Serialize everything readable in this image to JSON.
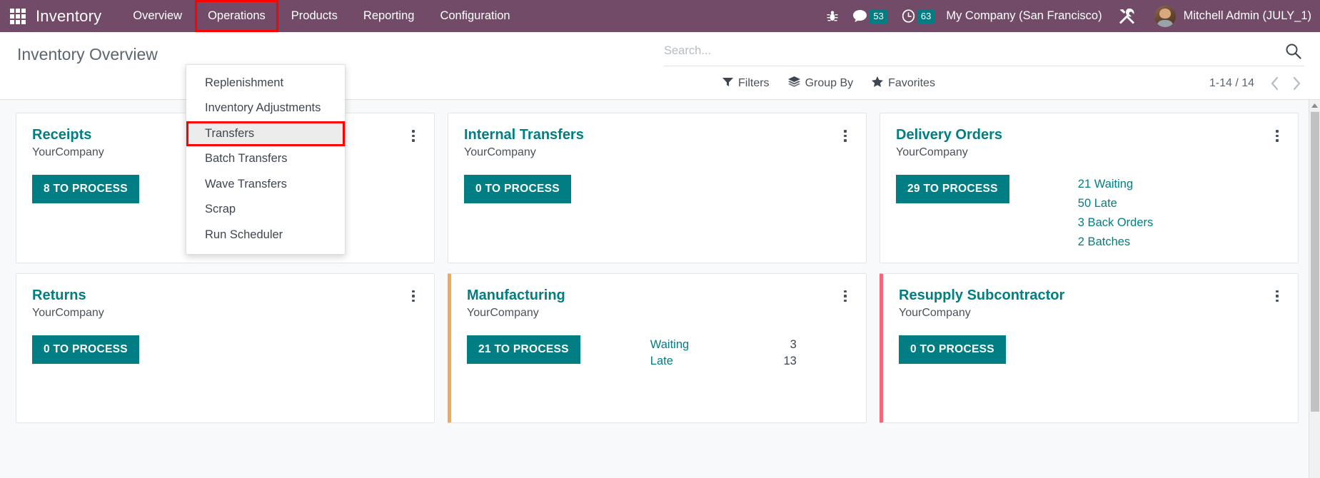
{
  "navbar": {
    "apps_icon": "apps-grid-icon",
    "brand": "Inventory",
    "menu": [
      {
        "label": "Overview",
        "highlighted": false
      },
      {
        "label": "Operations",
        "highlighted": true
      },
      {
        "label": "Products",
        "highlighted": false
      },
      {
        "label": "Reporting",
        "highlighted": false
      },
      {
        "label": "Configuration",
        "highlighted": false
      }
    ],
    "bug_icon": "bug-icon",
    "messages": {
      "icon": "chat-bubble-icon",
      "count": "53"
    },
    "activities": {
      "icon": "clock-icon",
      "count": "63"
    },
    "company": "My Company (San Francisco)",
    "tools_icon": "tools-icon",
    "user": {
      "name": "Mitchell Admin (JULY_1)",
      "avatar": "user-avatar"
    },
    "accent_color": "#714B67",
    "badge_color": "#017e84"
  },
  "dropdown": {
    "open_for": "Operations",
    "items": [
      {
        "label": "Replenishment",
        "active": false
      },
      {
        "label": "Inventory Adjustments",
        "active": false
      },
      {
        "label": "Transfers",
        "active": true
      },
      {
        "label": "Batch Transfers",
        "active": false
      },
      {
        "label": "Wave Transfers",
        "active": false
      },
      {
        "label": "Scrap",
        "active": false
      },
      {
        "label": "Run Scheduler",
        "active": false
      }
    ],
    "highlight_color": "#ff0000"
  },
  "control_panel": {
    "title": "Inventory Overview",
    "search": {
      "placeholder": "Search...",
      "value": "",
      "icon": "search-icon"
    },
    "buttons": [
      {
        "label": "Filters",
        "icon": "filter-icon"
      },
      {
        "label": "Group By",
        "icon": "layers-icon"
      },
      {
        "label": "Favorites",
        "icon": "star-icon"
      }
    ],
    "pager": {
      "range": "1-14 / 14",
      "prev_icon": "chevron-left-icon",
      "next_icon": "chevron-right-icon"
    }
  },
  "kanban": {
    "cards": [
      {
        "title": "Receipts",
        "company": "YourCompany",
        "button": "8 TO PROCESS",
        "accent": "none",
        "links": [],
        "stats": []
      },
      {
        "title": "Internal Transfers",
        "company": "YourCompany",
        "button": "0 TO PROCESS",
        "accent": "none",
        "links": [],
        "stats": []
      },
      {
        "title": "Delivery Orders",
        "company": "YourCompany",
        "button": "29 TO PROCESS",
        "accent": "none",
        "links": [
          "21 Waiting",
          "50 Late",
          "3 Back Orders",
          "2 Batches"
        ],
        "stats": []
      },
      {
        "title": "Returns",
        "company": "YourCompany",
        "button": "0 TO PROCESS",
        "accent": "none",
        "links": [],
        "stats": []
      },
      {
        "title": "Manufacturing",
        "company": "YourCompany",
        "button": "21 TO PROCESS",
        "accent": "orange",
        "accent_color": "#f0a85c",
        "links": [],
        "stats": [
          {
            "label": "Waiting",
            "value": "3"
          },
          {
            "label": "Late",
            "value": "13"
          }
        ]
      },
      {
        "title": "Resupply Subcontractor",
        "company": "YourCompany",
        "button": "0 TO PROCESS",
        "accent": "red",
        "accent_color": "#f0687a",
        "links": [],
        "stats": []
      }
    ],
    "title_color": "#017e84",
    "button_color": "#017e84"
  },
  "scrollbar": {
    "up_arrow_icon": "scroll-up-arrow-icon"
  }
}
